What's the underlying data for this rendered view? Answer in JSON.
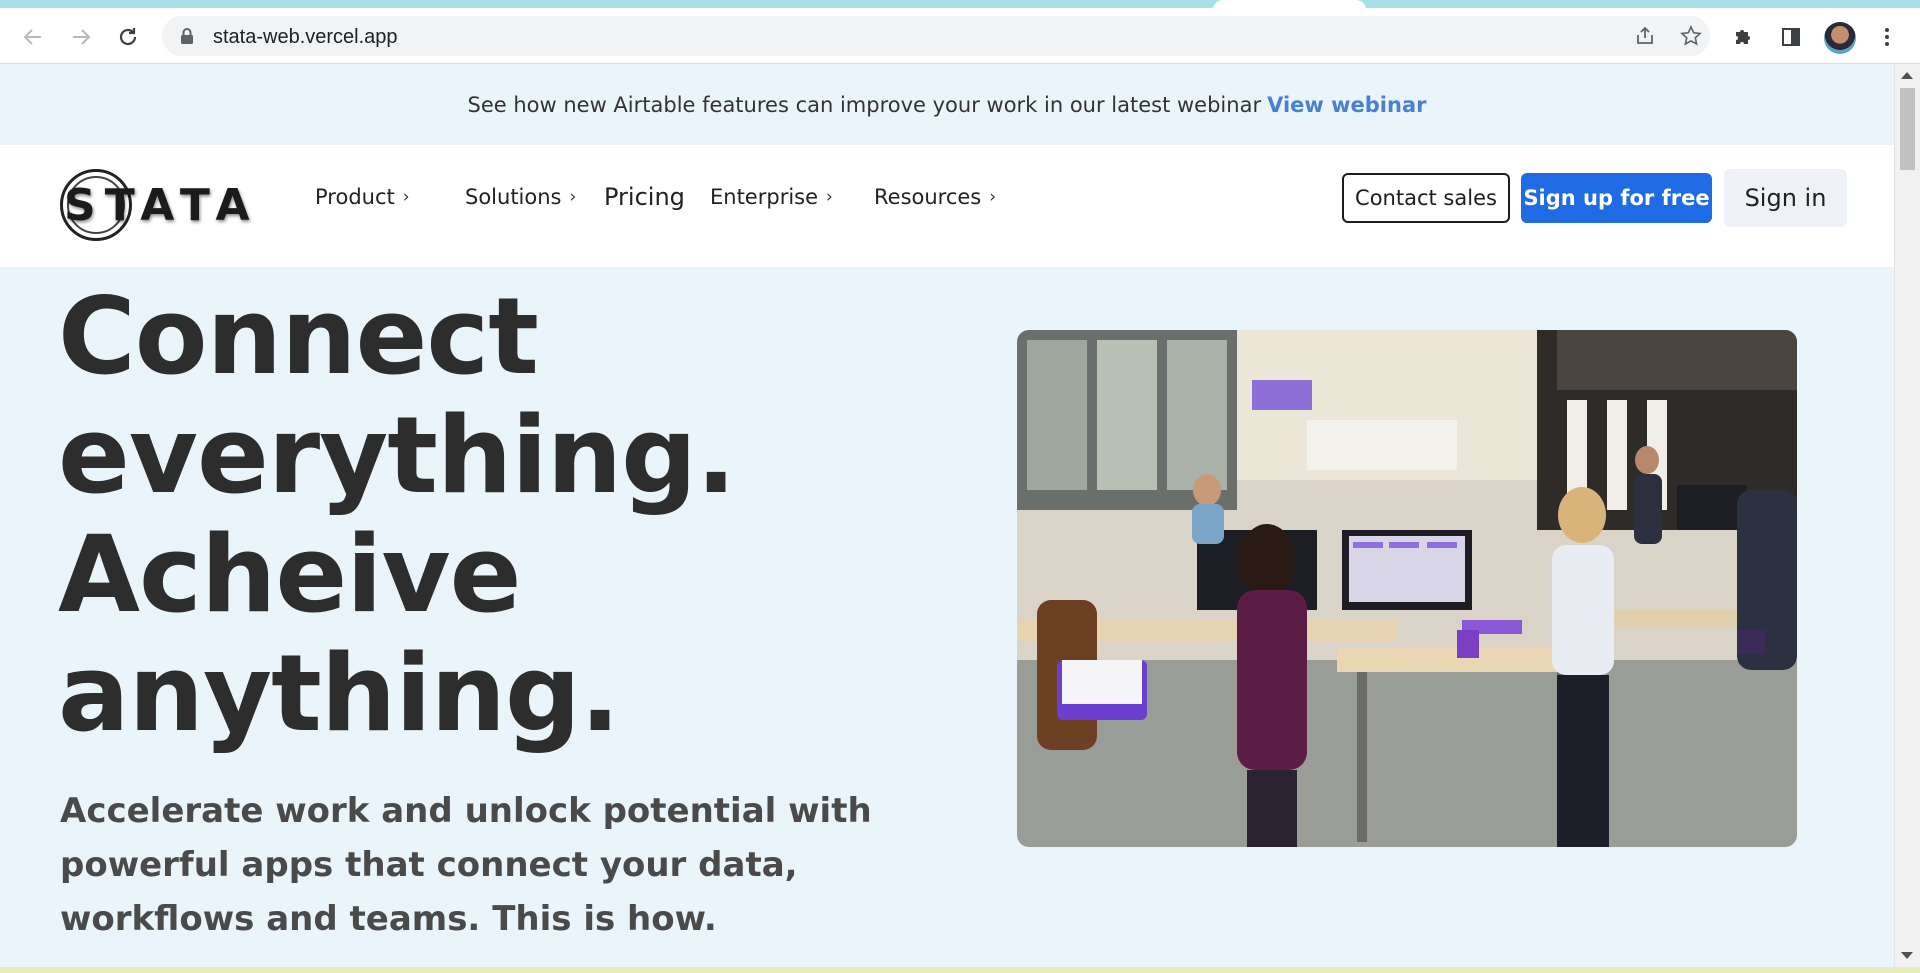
{
  "browser": {
    "url": "stata-web.vercel.app",
    "icons": {
      "back": "arrow-left-icon",
      "forward": "arrow-right-icon",
      "reload": "reload-icon",
      "lock": "lock-icon",
      "share": "share-icon",
      "bookmark": "star-icon",
      "extensions": "puzzle-icon",
      "side_panel": "side-panel-icon",
      "menu": "kebab-menu-icon"
    }
  },
  "banner": {
    "text": "See how new Airtable features can improve your work in our latest webinar",
    "link": "View webinar"
  },
  "nav": {
    "logo_text": "STATA",
    "items": [
      {
        "label": "Product",
        "has_chevron": true
      },
      {
        "label": "Solutions",
        "has_chevron": true
      },
      {
        "label": "Pricing",
        "has_chevron": false
      },
      {
        "label": "Enterprise",
        "has_chevron": true
      },
      {
        "label": "Resources",
        "has_chevron": true
      }
    ],
    "contact_label": "Contact sales",
    "signup_label": "Sign up for free",
    "signin_label": "Sign in"
  },
  "hero": {
    "title_lines": [
      "Connect",
      "everything.",
      "Acheive",
      "anything."
    ],
    "subtitle": "Accelerate work and unlock potential with powerful apps that connect your data, workflows and teams. This is how."
  },
  "colors": {
    "accent": "#1e6be4",
    "banner_link": "#4a7fd1",
    "page_bg": "#eaf4fb",
    "heading": "#2d2d2d"
  }
}
